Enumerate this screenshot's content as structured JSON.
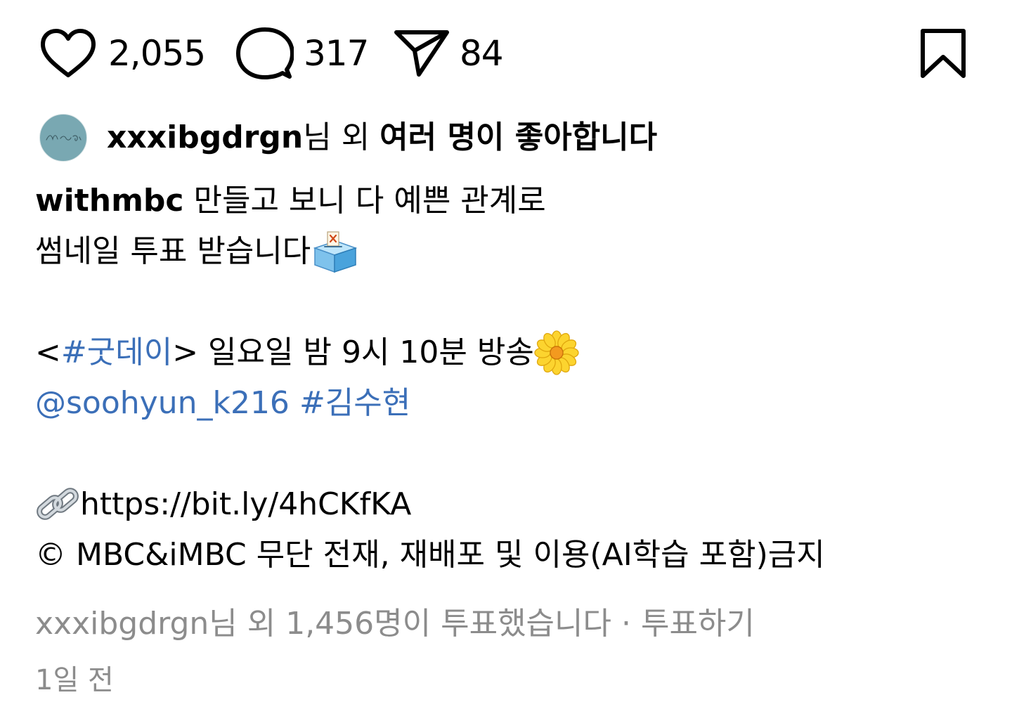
{
  "actions": {
    "likes_count": "2,055",
    "comments_count": "317",
    "shares_count": "84"
  },
  "liked_by": {
    "username": "xxxibgdrgn",
    "suffix_normal": "님 외 ",
    "suffix_bold": "여러 명이 좋아합니다"
  },
  "caption": {
    "author": "withmbc",
    "line1_text": " 만들고 보니 다 예쁜 관계로",
    "line2_text": "썸네일 투표 받습니다",
    "line2_emoji": "ballot-box-icon",
    "line3_open": "<",
    "line3_hashtag": "#굿데이",
    "line3_close": ">",
    "line3_text": " 일요일 밤 9시 10분 방송",
    "line3_emoji": "blossom-icon",
    "mention": "@soohyun_k216",
    "hashtag2": "#김수현",
    "link_emoji": "link-icon",
    "url": "https://bit.ly/4hCKfKA",
    "copyright": "© MBC&iMBC 무단 전재, 재배포 및 이용(AI학습 포함)금지"
  },
  "vote": {
    "text": "xxxibgdrgn님 외 1,456명이 투표했습니다",
    "separator": " · ",
    "action": "투표하기"
  },
  "timestamp": "1일 전",
  "colors": {
    "link": "#3b6fb8",
    "secondary_text": "#8c8c8c",
    "avatar": "#79a8b2"
  }
}
